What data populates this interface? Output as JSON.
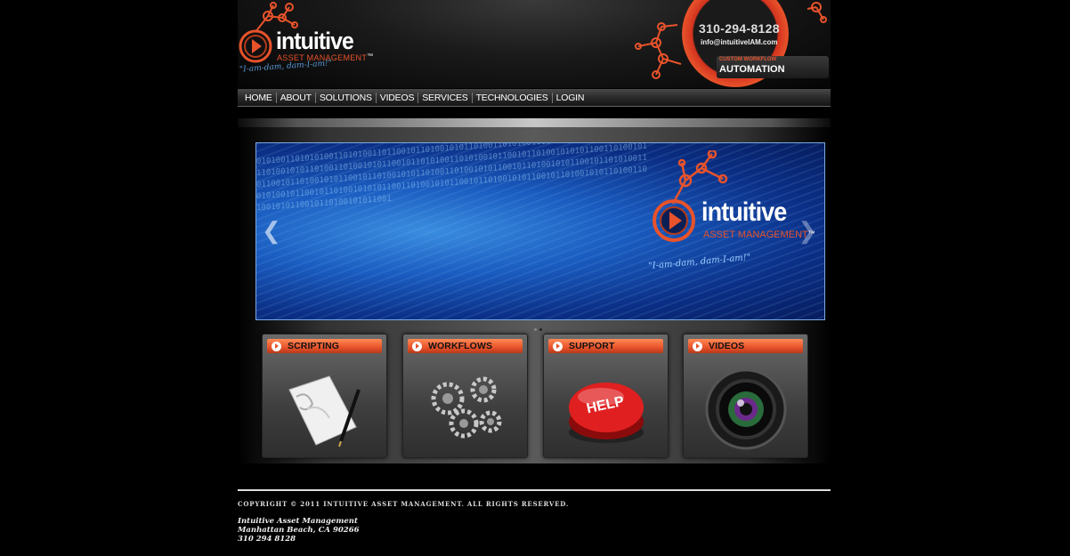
{
  "header": {
    "logo_word": "intuitive",
    "logo_sub": "ASSET MANAGEMENT",
    "logo_tm": "™",
    "logo_tagline": "\"I-am-dam, dam-I-am!\"",
    "phone": "310-294-8128",
    "email": "info@intuitiveIAM.com",
    "promo_small": "CUSTOM WORKFLOW",
    "promo_big": "AUTOMATION"
  },
  "nav": {
    "items": [
      "HOME",
      "ABOUT",
      "SOLUTIONS",
      "VIDEOS",
      "SERVICES",
      "TECHNOLOGIES",
      "LOGIN"
    ]
  },
  "slider": {
    "logo_word": "intuitive",
    "logo_sub": "ASSET MANAGEMENT",
    "logo_tm": "™",
    "tagline": "\"I-am-dam, dam-I-am!\"",
    "prev": "❮",
    "next": "❯",
    "binary": "0101001101010100110101001101100101101001010110100110101001101001011010010101100101101001010110100110100101011001011010100110101001011001011010010101011001101001010110010110100101011001011010010101101001101001010110010110100101011001011010100110101001011001011010010101011001101001010110010110100101011001011010010101101001101001010110010110100101011001"
  },
  "tiles": [
    {
      "label": "SCRIPTING",
      "icon": "script-scroll-pen"
    },
    {
      "label": "WORKFLOWS",
      "icon": "gears"
    },
    {
      "label": "SUPPORT",
      "icon": "help-button",
      "icon_text": "HELP"
    },
    {
      "label": "VIDEOS",
      "icon": "camera-lens"
    }
  ],
  "footer": {
    "copyright": "COPYRIGHT © 2011 INTUITIVE ASSET MANAGEMENT. ALL RIGHTS RESERVED.",
    "company": "Intuitive Asset Management",
    "city": "Manhattan Beach, CA 90266",
    "phone": "310 294 8128"
  },
  "colors": {
    "accent": "#e8532b",
    "background": "#000000"
  }
}
